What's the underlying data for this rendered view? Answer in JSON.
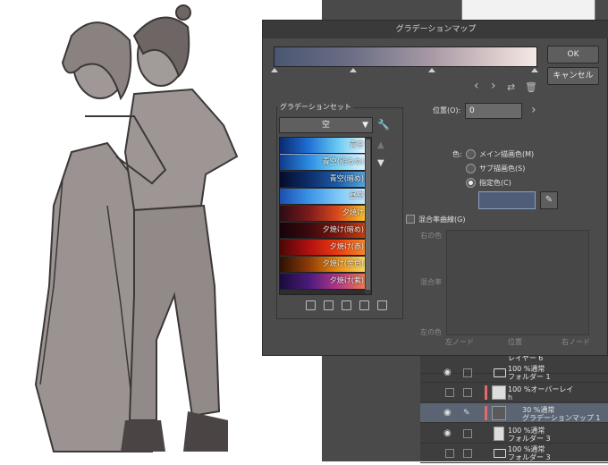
{
  "dialog": {
    "title": "グラデーションマップ",
    "ok_label": "OK",
    "cancel_label": "キャンセル"
  },
  "gradient_set": {
    "label": "グラデーションセット",
    "selected": "空",
    "items": [
      {
        "label": "青空",
        "colors": [
          "#0a2a6e",
          "#1e6fd6",
          "#66c8f0",
          "#e6f6ff"
        ]
      },
      {
        "label": "青空(明るめ)",
        "colors": [
          "#103a8a",
          "#2a8ae0",
          "#7ad4f4",
          "#dff4ff"
        ]
      },
      {
        "label": "青空(暗め)",
        "colors": [
          "#050c2a",
          "#0d2d6a",
          "#1d5aa6",
          "#5aa6d8"
        ]
      },
      {
        "label": "昼空",
        "colors": [
          "#1a4fae",
          "#3a92e6",
          "#7cc6f4",
          "#c8e8fb"
        ]
      },
      {
        "label": "夕焼け",
        "colors": [
          "#2a0d14",
          "#7a1a1a",
          "#d8481e",
          "#f8c428"
        ]
      },
      {
        "label": "夕焼け(暗め)",
        "colors": [
          "#140409",
          "#3a0a0e",
          "#7a160e",
          "#c8400e"
        ]
      },
      {
        "label": "夕焼け(赤)",
        "colors": [
          "#4a0606",
          "#b01010",
          "#ea3a10",
          "#fa8a28"
        ]
      },
      {
        "label": "夕焼け(金色)",
        "colors": [
          "#2a1206",
          "#8a3a08",
          "#e88a10",
          "#fad860"
        ]
      },
      {
        "label": "夕焼け(紫)",
        "colors": [
          "#1a0a3a",
          "#4a1a7a",
          "#b0368a",
          "#f07a4a"
        ]
      }
    ]
  },
  "position": {
    "label": "位置(O):",
    "value": "0"
  },
  "color": {
    "label": "色:",
    "options": [
      "メイン描画色(M)",
      "サブ描画色(S)",
      "指定色(C)"
    ],
    "selected_index": 2,
    "swatch_color": "#4f5d78"
  },
  "blend_curve": {
    "label": "混合率曲線(G)",
    "right_color": "右の色",
    "rate": "混合率",
    "left_color": "左の色",
    "left_node": "左ノード",
    "position": "位置",
    "right_node": "右ノード"
  },
  "layers": [
    {
      "line1": "レイヤー 6",
      "line2": ""
    },
    {
      "line1": "100 %通常",
      "line2": "フォルダー 1"
    },
    {
      "line1": "100 %オーバーレイ",
      "line2": "h"
    },
    {
      "line1": "30 %通常",
      "line2": "グラデーションマップ 1"
    },
    {
      "line1": "100 %通常",
      "line2": "フォルダー 3"
    },
    {
      "line1": "100 %通常",
      "line2": "フォルダー 3"
    }
  ]
}
